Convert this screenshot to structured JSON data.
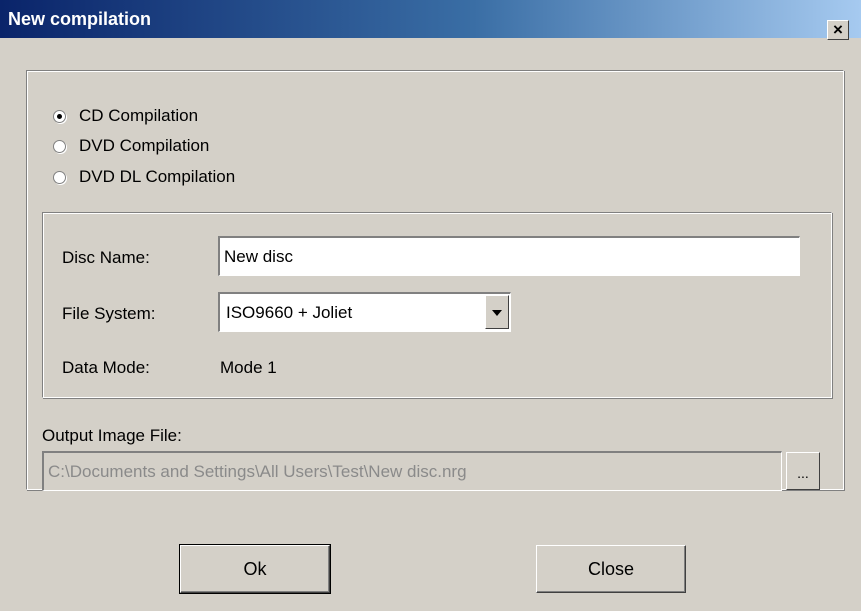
{
  "window": {
    "title": "New compilation",
    "close_label": "×"
  },
  "compilation_type": {
    "options": [
      {
        "label": "CD Compilation",
        "selected": true
      },
      {
        "label": "DVD Compilation",
        "selected": false
      },
      {
        "label": "DVD DL Compilation",
        "selected": false
      }
    ]
  },
  "disc": {
    "name_label": "Disc Name:",
    "name_value": "New disc",
    "filesystem_label": "File System:",
    "filesystem_value": "ISO9660 + Joliet",
    "datamode_label": "Data Mode:",
    "datamode_value": "Mode 1"
  },
  "output": {
    "label": "Output Image File:",
    "path": "C:\\Documents and Settings\\All Users\\Test\\New disc.nrg",
    "browse_label": "..."
  },
  "buttons": {
    "ok_label": "Ok",
    "close_label": "Close"
  }
}
